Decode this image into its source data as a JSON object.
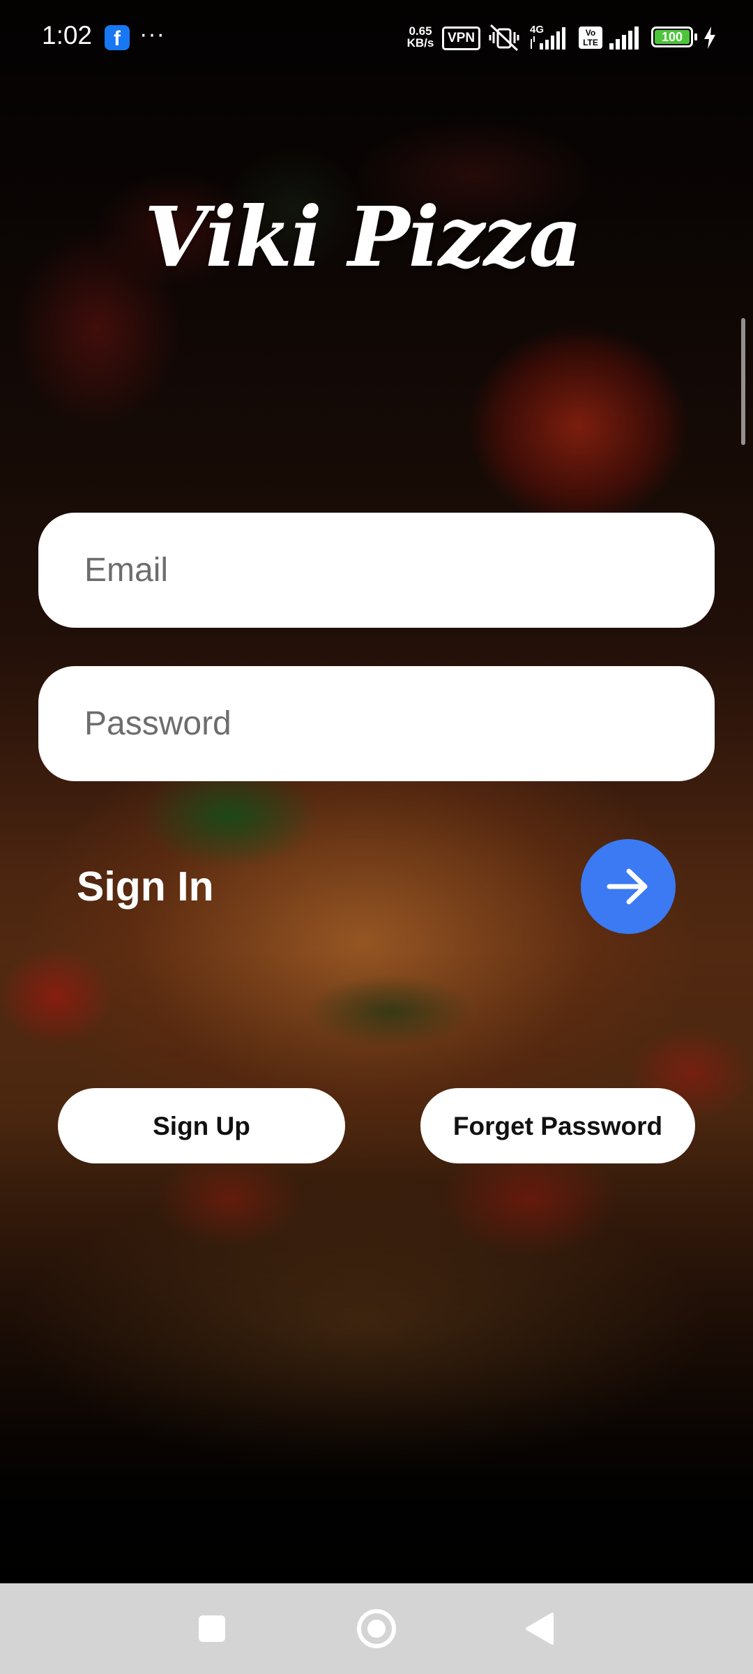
{
  "status_bar": {
    "time": "1:02",
    "notification_icons": [
      "facebook-icon",
      "more-icon"
    ],
    "net_speed_value": "0.65",
    "net_speed_unit": "KB/s",
    "vpn_label": "VPN",
    "network_label_1": "4G",
    "volte_line1": "Vo",
    "volte_line2": "LTE",
    "battery_level": "100",
    "charging": true
  },
  "app": {
    "title": "Viki Pizza"
  },
  "form": {
    "email_placeholder": "Email",
    "email_value": "",
    "password_placeholder": "Password",
    "password_value": "",
    "sign_in_label": "Sign In",
    "submit_icon": "arrow-right-icon"
  },
  "actions": {
    "sign_up_label": "Sign Up",
    "forget_password_label": "Forget Password"
  },
  "colors": {
    "accent": "#3b7af2",
    "field_bg": "#ffffff",
    "nav_bar_bg": "#d4d4d4",
    "battery_green": "#4cc53a"
  },
  "nav_bar": {
    "buttons": [
      "recents-icon",
      "home-icon",
      "back-icon"
    ]
  }
}
